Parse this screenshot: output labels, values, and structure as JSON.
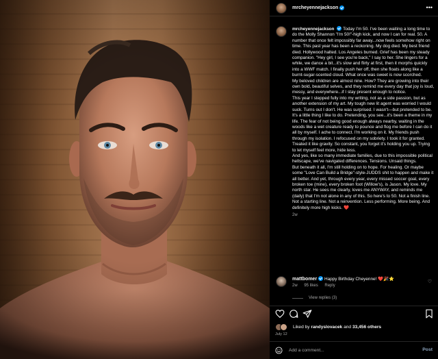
{
  "post": {
    "username": "mrcheyennejackson",
    "more_icon": "more-horizontal-icon",
    "caption_paragraphs": [
      "Today I'm 50. I've been waiting a long time to do the Molly Shannon \"I'm 50!\"-high kick, and now I can for real. 50. A number that once felt impossibly far away...now feels somehow right on time. This past year has been a reckoning. My dog died. My best friend died. Hollywood halted. Los Angeles burned. Grief has been my steady companion. \"Hey girl, I see you're back,\" I say to her. She lingers for a while, we dance a bit...it's slow and flirty at first, then it morphs quickly into a WWF match. I finally push her off, then she floats along like a burnt-sugar-scented cloud. What once was sweet is now scorched.",
      "My beloved children are almost nine. How? They are growing into their own bold, beautiful selves, and they remind me every day that joy is loud, messy, and everywhere...if I stay present enough to notice.",
      "This year I stepped fully into my writing, not as a side passion, but as another extension of my art. My tough new lit agent was worried I would suck. Turns out I don't. He was surprised. I wasn't—but pretended to be. It's a little thing I like to do. Pretending, you see...it's been a theme in my life. The fear of not being good enough always nearby, waiting in the woods like a wet creature ready to pounce and flog me before I can do it all by myself. I ache to connect. I'm working on it. My friends push through my isolation. I refocused on my sobriety. I took it for granted. Treated it like gravity. So constant, you forget it's holding you up. Trying to let myself feel more, hide less.",
      "And yes, like so many immediate families, due to this impossible political hellscape, we've navigated differences. Tensions. Unsaid things.",
      "But beneath it all, I'm still holding on to hope. For healing. Or maybe some \"Love Can Build a Bridge\"-style-JUDDS shit to happen and make it all better. And yet, through every year, every missed soccer goal, every broken toe (mine), every broken foot (Willow's), is Jason. My love. My north star. He sees me clearly, loves me ANYWAY, and reminds me (daily) that I'm not alone in any of this. So here's to 50. Not a finish line. Not a starting line. Not a reinvention. Less performing. More being. And definitely more high kicks. ❤️"
    ],
    "caption_time": "2w"
  },
  "comment": {
    "username": "mattbomer",
    "text": "Happy Birthday Cheyenne! ❤️🎉⭐",
    "time": "2w",
    "likes": "95 likes",
    "reply": "Reply",
    "heart_icon": "heart-outline-icon"
  },
  "view_replies": "View replies (3)",
  "actions": {
    "like_icon": "heart-icon",
    "comment_icon": "comment-icon",
    "share_icon": "send-icon",
    "save_icon": "bookmark-icon"
  },
  "likes": {
    "prefix": "Liked by ",
    "user": "randyslovacek",
    "middle": " and ",
    "count": "33,456 others"
  },
  "date": "July 12",
  "add_comment": {
    "placeholder": "Add a comment...",
    "post_label": "Post",
    "emoji_icon": "smiley-icon"
  }
}
